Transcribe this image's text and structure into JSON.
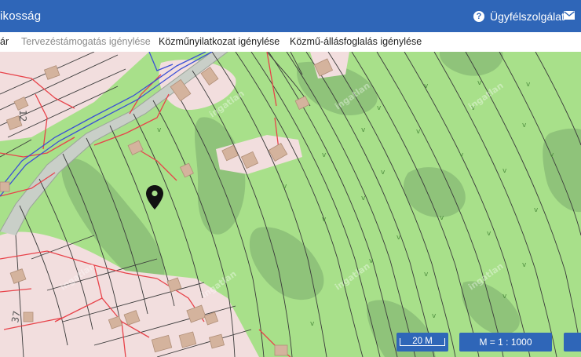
{
  "header": {
    "title": "ikosság",
    "support_label": "Ügyfélszolgálat",
    "icons": {
      "help": "help-circle-icon",
      "mail": "mail-icon"
    },
    "colors": {
      "bar": "#2f66b8",
      "text": "#ffffff"
    }
  },
  "tabs": [
    {
      "label": "ár",
      "state": "normal"
    },
    {
      "label": "Tervezéstámogatás igénylése",
      "state": "muted"
    },
    {
      "label": "Közműnyilatkozat igénylése",
      "state": "normal"
    },
    {
      "label": "Közmű-állásfoglalás igénylése",
      "state": "normal"
    }
  ],
  "map": {
    "colors": {
      "land": "#a8e08a",
      "forest": "#8fc37a",
      "road": "#c9cfc8",
      "residential": "#f2dede",
      "building": "#d4b39d",
      "parcel_line": "#3a3a3a",
      "electric_line": "#e8434a",
      "gas_line": "#3a4fd6"
    },
    "street_numbers": [
      "12",
      "37"
    ],
    "watermark": "ingatlan",
    "marker_icon": "map-pin-icon"
  },
  "controls": {
    "scale_label": "20 M",
    "ratio_label": "M = 1 : 1000"
  }
}
